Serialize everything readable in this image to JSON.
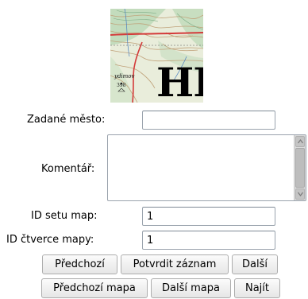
{
  "map_thumbnail": {
    "letters": "HL",
    "place_label": "ydimov",
    "height_label": "398"
  },
  "form": {
    "city": {
      "label": "Zadané město:",
      "value": ""
    },
    "comment": {
      "label": "Komentář:",
      "value": ""
    },
    "map_set_id": {
      "label": "ID setu map:",
      "value": "1"
    },
    "map_square_id": {
      "label": "ID čtverce mapy:",
      "value": "1"
    }
  },
  "buttons": {
    "previous": "Předchozí",
    "confirm_record": "Potvrdit záznam",
    "next": "Další",
    "previous_map": "Předchozí mapa",
    "next_map": "Další mapa",
    "find": "Najít"
  },
  "colors": {
    "map_paper": "#e8ecd9",
    "contour_line": "#c0a27a",
    "road_red": "#d43a3a",
    "forest_green": "#7fae86"
  }
}
